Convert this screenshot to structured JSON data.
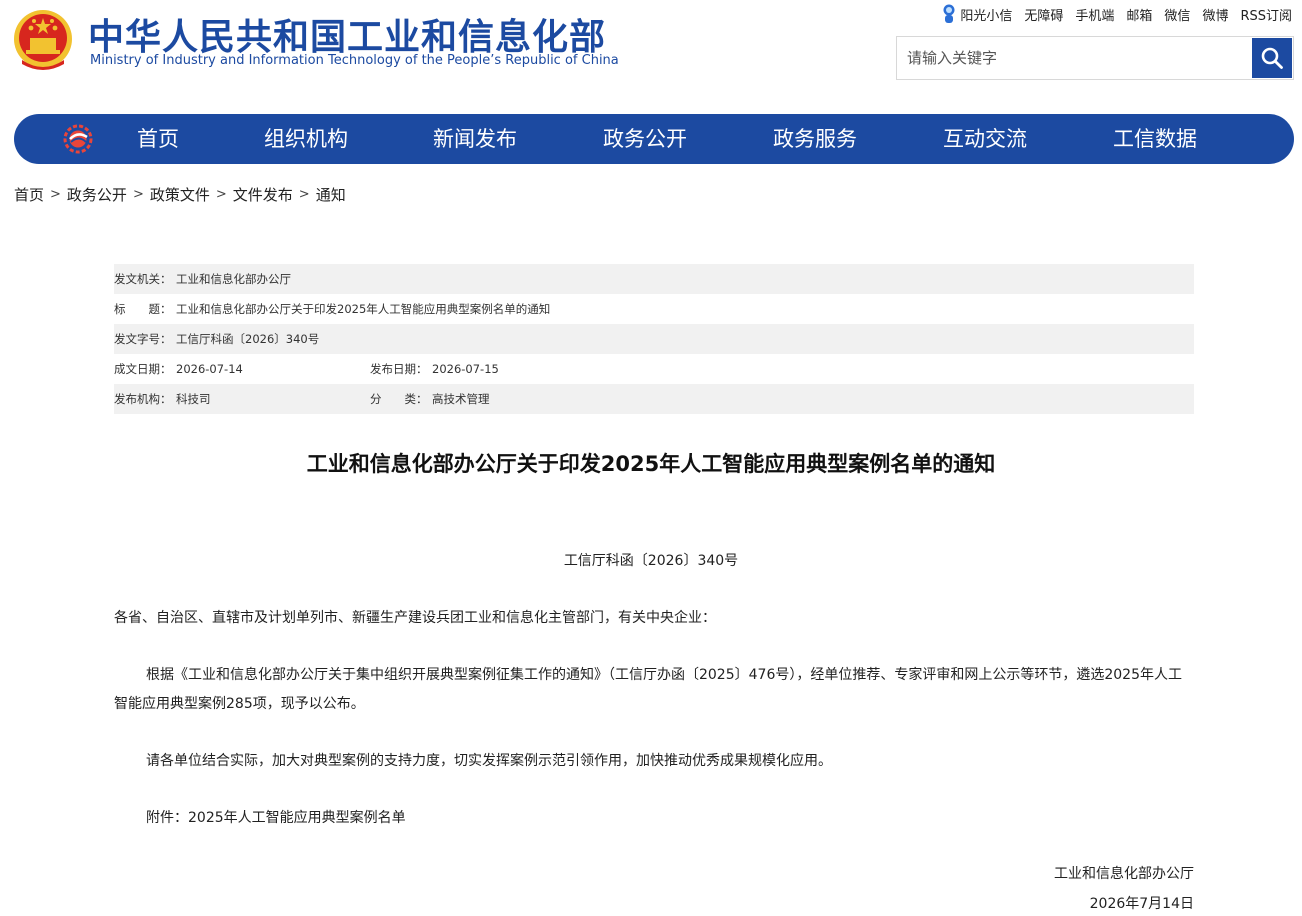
{
  "header": {
    "title_cn": "中华人民共和国工业和信息化部",
    "title_en": "Ministry of Industry and Information Technology of the People’s Republic of China",
    "top_links": [
      "阳光小信",
      "无障碍",
      "手机端",
      "邮箱",
      "微信",
      "微博",
      "RSS订阅"
    ],
    "search_placeholder": "请输入关键字"
  },
  "nav": {
    "items": [
      "首页",
      "组织机构",
      "新闻发布",
      "政务公开",
      "政务服务",
      "互动交流",
      "工信数据"
    ]
  },
  "breadcrumb": [
    "首页",
    "政务公开",
    "政策文件",
    "文件发布",
    "通知"
  ],
  "meta": {
    "issuer_label": "发文机关：",
    "issuer": "工业和信息化部办公厅",
    "title_label": "标　　题：",
    "title": "工业和信息化部办公厅关于印发2025年人工智能应用典型案例名单的通知",
    "docno_label": "发文字号：",
    "docno": "工信厅科函〔2026〕340号",
    "created_label": "成文日期：",
    "created": "2026-07-14",
    "published_label": "发布日期：",
    "published": "2026-07-15",
    "org_label": "发布机构：",
    "org": "科技司",
    "category_label": "分　　类：",
    "category": "高技术管理"
  },
  "article": {
    "title": "工业和信息化部办公厅关于印发2025年人工智能应用典型案例名单的通知",
    "doc_number": "工信厅科函〔2026〕340号",
    "salutation": "各省、自治区、直辖市及计划单列市、新疆生产建设兵团工业和信息化主管部门，有关中央企业：",
    "para1": "根据《工业和信息化部办公厅关于集中组织开展典型案例征集工作的通知》（工信厅办函〔2025〕476号），经单位推荐、专家评审和网上公示等环节，遴选2025年人工智能应用典型案例285项，现予以公布。",
    "para2": "请各单位结合实际，加大对典型案例的支持力度，切实发挥案例示范引领作用，加快推动优秀成果规模化应用。",
    "attachment": "附件：2025年人工智能应用典型案例名单",
    "signer": "工业和信息化部办公厅",
    "date": "2026年7月14日"
  },
  "colors": {
    "brand_blue": "#1c4aa1",
    "emblem_red": "#d7261e",
    "emblem_gold": "#f2c230"
  }
}
